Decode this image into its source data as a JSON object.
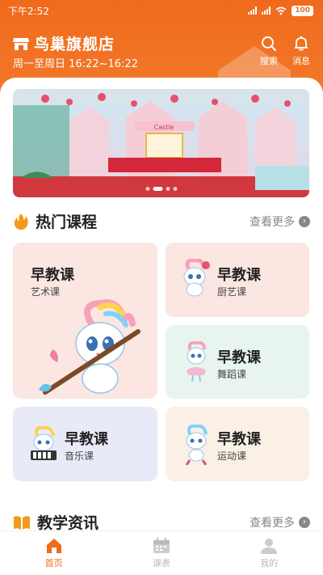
{
  "status": {
    "time": "下午2:52",
    "signal1": "HD",
    "battery": "100"
  },
  "header": {
    "store_name": "鸟巢旗舰店",
    "hours": "周一至周日 16:22~16:22",
    "search_label": "搜索",
    "messages_label": "消息"
  },
  "banner": {
    "sign_text": "Castle"
  },
  "hot_courses": {
    "title": "热门课程",
    "more": "查看更多",
    "cards": [
      {
        "title": "早教课",
        "sub": "艺术课",
        "bg": "#fbe6e1"
      },
      {
        "title": "早教课",
        "sub": "厨艺课",
        "bg": "#fbe6e1"
      },
      {
        "title": "早教课",
        "sub": "舞蹈课",
        "bg": "#e8f5ef"
      },
      {
        "title": "早教课",
        "sub": "音乐课",
        "bg": "#e9eaf7"
      },
      {
        "title": "早教课",
        "sub": "运动课",
        "bg": "#fbf0e6"
      }
    ]
  },
  "news": {
    "title": "教学资讯",
    "more": "查看更多"
  },
  "tabs": [
    {
      "label": "首页",
      "active": true
    },
    {
      "label": "课表",
      "active": false
    },
    {
      "label": "我的",
      "active": false
    }
  ],
  "colors": {
    "brand": "#f06a1c",
    "hot_icon": "#f39a1b"
  }
}
